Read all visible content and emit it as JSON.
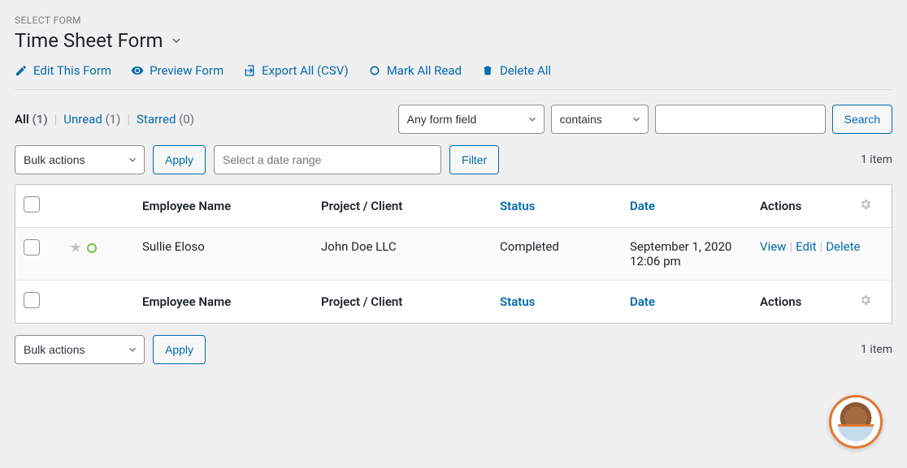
{
  "header": {
    "select_label": "SELECT FORM",
    "title": "Time Sheet Form"
  },
  "action_links": {
    "edit": "Edit This Form",
    "preview": "Preview Form",
    "export": "Export All (CSV)",
    "mark_read": "Mark All Read",
    "delete_all": "Delete All"
  },
  "subsub": {
    "all_label": "All",
    "all_count": "(1)",
    "unread_label": "Unread",
    "unread_count": "(1)",
    "starred_label": "Starred",
    "starred_count": "(0)"
  },
  "filters": {
    "field_select": "Any form field",
    "operator": "contains",
    "search_value": "",
    "search_btn": "Search",
    "bulk": "Bulk actions",
    "apply": "Apply",
    "date_placeholder": "Select a date range",
    "filter_btn": "Filter",
    "item_count": "1 item"
  },
  "columns": {
    "c1": "Employee Name",
    "c2": "Project / Client",
    "c3": "Status",
    "c4": "Date",
    "c5": "Actions"
  },
  "rows": [
    {
      "employee": "Sullie Eloso",
      "project": "John Doe LLC",
      "status": "Completed",
      "date": "September 1, 2020 12:06 pm",
      "view": "View",
      "edit": "Edit",
      "delete": "Delete"
    }
  ],
  "footer": {
    "bulk": "Bulk actions",
    "apply": "Apply",
    "item_count": "1 item"
  }
}
